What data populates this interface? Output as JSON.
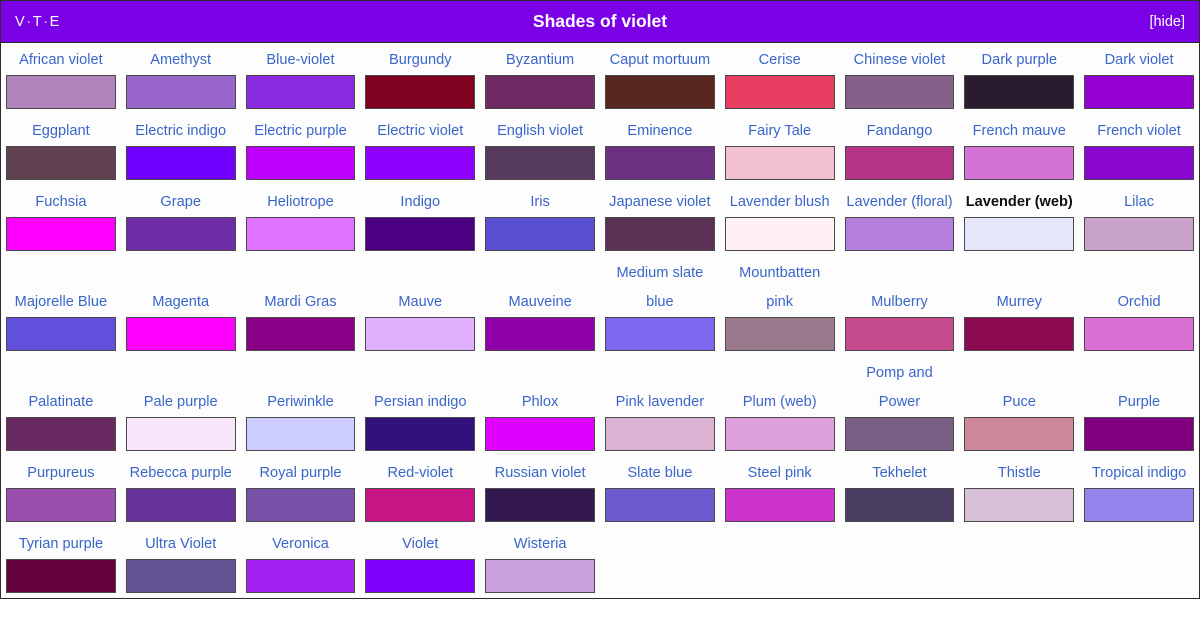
{
  "navbox": {
    "title": "Shades of violet",
    "vte": {
      "view": "V",
      "talk": "T",
      "edit": "E",
      "separator": "·"
    },
    "hide_label": "[hide]",
    "title_bar_color": "#7a00e6",
    "link_color": "#3a66c9",
    "current_page_color": "#101010",
    "border_color": "#2b2b2b",
    "background_color": "#fdfdfd",
    "rows": [
      [
        {
          "label": "African violet",
          "color": "#b284be",
          "current": false
        },
        {
          "label": "Amethyst",
          "color": "#9966cc",
          "current": false
        },
        {
          "label": "Blue-violet",
          "color": "#8a2be2",
          "current": false
        },
        {
          "label": "Burgundy",
          "color": "#800020",
          "current": false
        },
        {
          "label": "Byzantium",
          "color": "#702963",
          "current": false
        },
        {
          "label": "Caput mortuum",
          "color": "#592720",
          "current": false
        },
        {
          "label": "Cerise",
          "color": "#e73e62",
          "current": false
        },
        {
          "label": "Chinese violet",
          "color": "#856088",
          "current": false
        },
        {
          "label": "Dark purple",
          "color": "#2b1b2e",
          "current": false
        },
        {
          "label": "Dark violet",
          "color": "#9400d3",
          "current": false
        }
      ],
      [
        {
          "label": "Eggplant",
          "color": "#614051",
          "current": false
        },
        {
          "label": "Electric indigo",
          "color": "#6f00ff",
          "current": false
        },
        {
          "label": "Electric purple",
          "color": "#bf00ff",
          "current": false
        },
        {
          "label": "Electric violet",
          "color": "#8f00ff",
          "current": false
        },
        {
          "label": "English violet",
          "color": "#563c5c",
          "current": false
        },
        {
          "label": "Eminence",
          "color": "#6c3082",
          "current": false
        },
        {
          "label": "Fairy Tale",
          "color": "#f2c1d1",
          "current": false
        },
        {
          "label": "Fandango",
          "color": "#b53389",
          "current": false
        },
        {
          "label": "French mauve",
          "color": "#d473d4",
          "current": false
        },
        {
          "label": "French violet",
          "color": "#8806ce",
          "current": false
        }
      ],
      [
        {
          "label": "Fuchsia",
          "color": "#ff00ff",
          "current": false
        },
        {
          "label": "Grape",
          "color": "#6f2da8",
          "current": false
        },
        {
          "label": "Heliotrope",
          "color": "#df73ff",
          "current": false
        },
        {
          "label": "Indigo",
          "color": "#4b0082",
          "current": false
        },
        {
          "label": "Iris",
          "color": "#5a4fcf",
          "current": false
        },
        {
          "label": "Japanese violet",
          "color": "#5b3256",
          "current": false
        },
        {
          "label": "Lavender blush",
          "color": "#fff0f5",
          "current": false
        },
        {
          "label": "Lavender (floral)",
          "color": "#b57edc",
          "current": false
        },
        {
          "label": "Lavender (web)",
          "color": "#e6e6fa",
          "current": true
        },
        {
          "label": "Lilac",
          "color": "#c8a2c8",
          "current": false
        }
      ],
      [
        {
          "label": "Majorelle Blue",
          "color": "#6050dc",
          "current": false
        },
        {
          "label": "Magenta",
          "color": "#ff00ff",
          "current": false
        },
        {
          "label": "Mardi Gras",
          "color": "#880085",
          "current": false
        },
        {
          "label": "Mauve",
          "color": "#e0b0ff",
          "current": false
        },
        {
          "label": "Mauveine",
          "color": "#8f00a8",
          "current": false
        },
        {
          "label": "Medium slate blue",
          "color": "#7b68ee",
          "current": false
        },
        {
          "label": "Mountbatten pink",
          "color": "#997a8d",
          "current": false
        },
        {
          "label": "Mulberry",
          "color": "#c54b8c",
          "current": false
        },
        {
          "label": "Murrey",
          "color": "#8b0a50",
          "current": false
        },
        {
          "label": "Orchid",
          "color": "#da70d6",
          "current": false
        }
      ],
      [
        {
          "label": "Palatinate",
          "color": "#682860",
          "current": false
        },
        {
          "label": "Pale purple",
          "color": "#fae6fa",
          "current": false
        },
        {
          "label": "Periwinkle",
          "color": "#ccccff",
          "current": false
        },
        {
          "label": "Persian indigo",
          "color": "#32127a",
          "current": false
        },
        {
          "label": "Phlox",
          "color": "#df00ff",
          "current": false
        },
        {
          "label": "Pink lavender",
          "color": "#dbb2d1",
          "current": false
        },
        {
          "label": "Plum (web)",
          "color": "#dda0dd",
          "current": false
        },
        {
          "label": "Pomp and Power",
          "color": "#786085",
          "current": false
        },
        {
          "label": "Puce",
          "color": "#cc8899",
          "current": false
        },
        {
          "label": "Purple",
          "color": "#800080",
          "current": false
        }
      ],
      [
        {
          "label": "Purpureus",
          "color": "#9a4eae",
          "current": false
        },
        {
          "label": "Rebecca purple",
          "color": "#663399",
          "current": false
        },
        {
          "label": "Royal purple",
          "color": "#7851a9",
          "current": false
        },
        {
          "label": "Red-violet",
          "color": "#c71585",
          "current": false
        },
        {
          "label": "Russian violet",
          "color": "#32174d",
          "current": false
        },
        {
          "label": "Slate blue",
          "color": "#6a5acd",
          "current": false
        },
        {
          "label": "Steel pink",
          "color": "#cc33cc",
          "current": false
        },
        {
          "label": "Tekhelet",
          "color": "#493d61",
          "current": false
        },
        {
          "label": "Thistle",
          "color": "#d8bfd8",
          "current": false
        },
        {
          "label": "Tropical indigo",
          "color": "#9683ec",
          "current": false
        }
      ],
      [
        {
          "label": "Tyrian purple",
          "color": "#66023c",
          "current": false
        },
        {
          "label": "Ultra Violet",
          "color": "#645394",
          "current": false
        },
        {
          "label": "Veronica",
          "color": "#a020f0",
          "current": false
        },
        {
          "label": "Violet",
          "color": "#7f00ff",
          "current": false
        },
        {
          "label": "Wisteria",
          "color": "#c9a0dc",
          "current": false
        }
      ]
    ]
  }
}
